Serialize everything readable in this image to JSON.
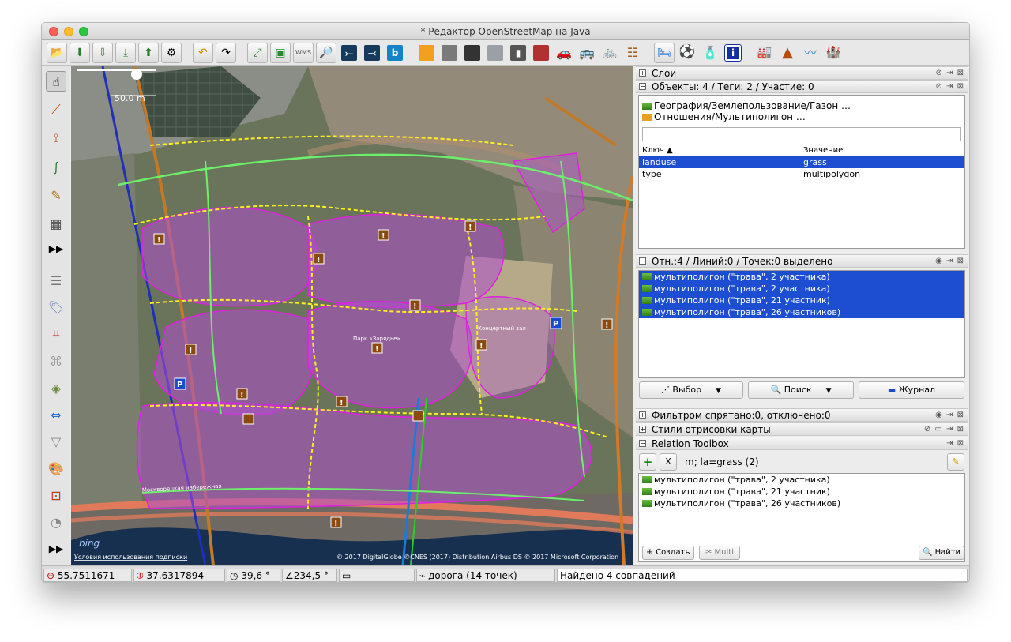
{
  "window": {
    "title": "* Редактор OpenStreetMap на Java"
  },
  "colors": {
    "selection": "#1d4ed2",
    "multipolygon_fill": "#b04fd0",
    "way_yellow": "#ffee22",
    "way_green": "#6cf06a"
  },
  "toolbar_icons": [
    "open-icon",
    "download-icon",
    "download-data-icon",
    "download-area-icon",
    "upload-icon",
    "preferences-icon",
    "undo-icon",
    "redo-icon",
    "zoom-extent-icon",
    "fit-icon",
    "wms-icon",
    "zoom-icon",
    "road-primary-icon",
    "road-secondary-icon",
    "bing-icon",
    "road-yellow-icon",
    "road-grey-icon",
    "road-dark-icon",
    "road-service-icon",
    "traffic-light-icon",
    "rail-icon",
    "car-icon",
    "bus-icon",
    "bicycle-icon",
    "railway-icon",
    "bed-icon",
    "football-icon",
    "shop-icon",
    "info-icon",
    "industrial-icon",
    "mountain-icon",
    "river-icon",
    "castle-icon"
  ],
  "map": {
    "scale_label": "50.0 m",
    "copyright": "© 2017 DigitalGlobe ©CNES (2017) Distribution Airbus DS © 2017 Microsoft Corporation",
    "bing_label": "bing",
    "terms_link": "Условия использования подписки",
    "park_label": "Парк «Зарядье»",
    "concert_label": "Концертный зал",
    "street_label": "Москворецкая набережная"
  },
  "panels": {
    "layers": {
      "title": "Слои"
    },
    "objects": {
      "title": "Объекты: 4 / Теги: 2 / Участие: 0",
      "presets": [
        "География/Землепользование/Газон …",
        "Отношения/Мультиполигон …"
      ],
      "col_key": "Ключ ▲",
      "col_value": "Значение",
      "rows": [
        {
          "key": "landuse",
          "value": "grass"
        },
        {
          "key": "type",
          "value": "multipolygon"
        }
      ]
    },
    "selection": {
      "title": "Отн.:4 / Линий:0 / Точек:0 выделено",
      "items": [
        "мультиполигон (\"трава\", 2 участника)",
        "мультиполигон (\"трава\", 2 участника)",
        "мультиполигон (\"трава\", 21 участник)",
        "мультиполигон (\"трава\", 26 участников)"
      ],
      "buttons": {
        "select": "Выбор",
        "search": "Поиск",
        "history": "Журнал"
      }
    },
    "filter": {
      "title": "Фильтром спрятано:0, отключено:0"
    },
    "styles": {
      "title": "Стили отрисовки карты"
    },
    "relation_toolbox": {
      "title": "Relation Toolbox",
      "add": "+",
      "remove": "X",
      "summary": "m; la=grass (2)",
      "items": [
        "мультиполигон (\"трава\", 2 участника)",
        "мультиполигон (\"трава\", 21 участник)",
        "мультиполигон (\"трава\", 26 участников)"
      ],
      "create": "Создать",
      "multi": "Multi",
      "find": "Найти"
    }
  },
  "status": {
    "lat": "55.7511671",
    "lon": "37.6317894",
    "heading": "39,6 °",
    "angle": "234,5 °",
    "distance": "--",
    "hover": "дорога (14 точек)",
    "message": "Найдено 4 совпадений"
  }
}
